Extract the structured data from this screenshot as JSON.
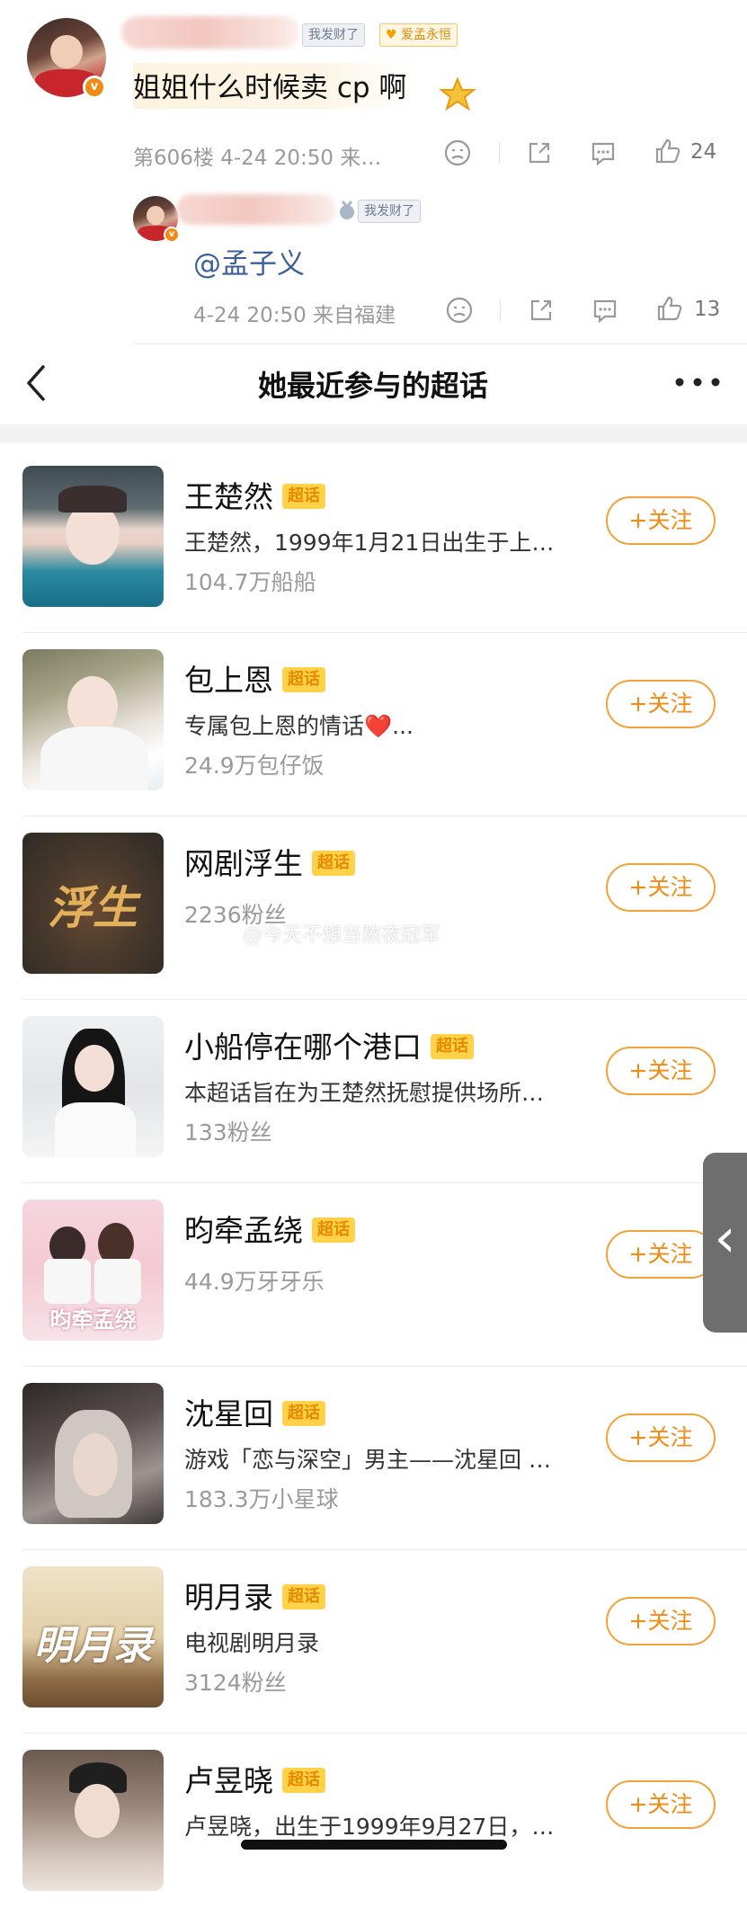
{
  "comment": {
    "user_tag_1": "我发财了",
    "user_tag_2": "爱孟永恒",
    "text": "姐姐什么时候卖 cp 啊",
    "floor_meta": "第606楼 4-24 20:50 来…",
    "like_count": "24"
  },
  "reply": {
    "user_tag": "我发财了",
    "text": "@孟子义",
    "meta": "4-24 20:50 来自福建",
    "like_count": "13"
  },
  "header": {
    "back_icon": "chevron-left-icon",
    "title": "她最近参与的超话",
    "more_icon": "more-dots-icon"
  },
  "topics": [
    {
      "name": "王楚然",
      "badge": "超话",
      "desc": "王楚然，1999年1月21日出生于上…",
      "fans": "104.7万船船",
      "follow": "+关注"
    },
    {
      "name": "包上恩",
      "badge": "超话",
      "desc": "专属包上恩的情话❤️...",
      "fans": "24.9万包仔饭",
      "follow": "+关注"
    },
    {
      "name": "网剧浮生",
      "badge": "超话",
      "desc": "",
      "fans": "2236粉丝",
      "follow": "+关注"
    },
    {
      "name": "小船停在哪个港口",
      "badge": "超话",
      "desc": "本超话旨在为王楚然抚慰提供场所…",
      "fans": "133粉丝",
      "follow": "+关注"
    },
    {
      "name": "昀牵孟绕",
      "badge": "超话",
      "desc": "",
      "fans": "44.9万牙牙乐",
      "follow": "+关注"
    },
    {
      "name": "沈星回",
      "badge": "超话",
      "desc": "游戏「恋与深空」男主——沈星回 …",
      "fans": "183.3万小星球",
      "follow": "+关注"
    },
    {
      "name": "明月录",
      "badge": "超话",
      "desc": "电视剧明月录",
      "fans": "3124粉丝",
      "follow": "+关注"
    },
    {
      "name": "卢昱晓",
      "badge": "超话",
      "desc": "卢昱晓，出生于1999年9月27日，…",
      "fans": "",
      "follow": "+关注"
    }
  ],
  "watermark": "@今天不想当熬夜冠军",
  "thumb_texts": {
    "t3": "浮生",
    "t5": "昀牵孟绕",
    "t7": "明月录"
  }
}
